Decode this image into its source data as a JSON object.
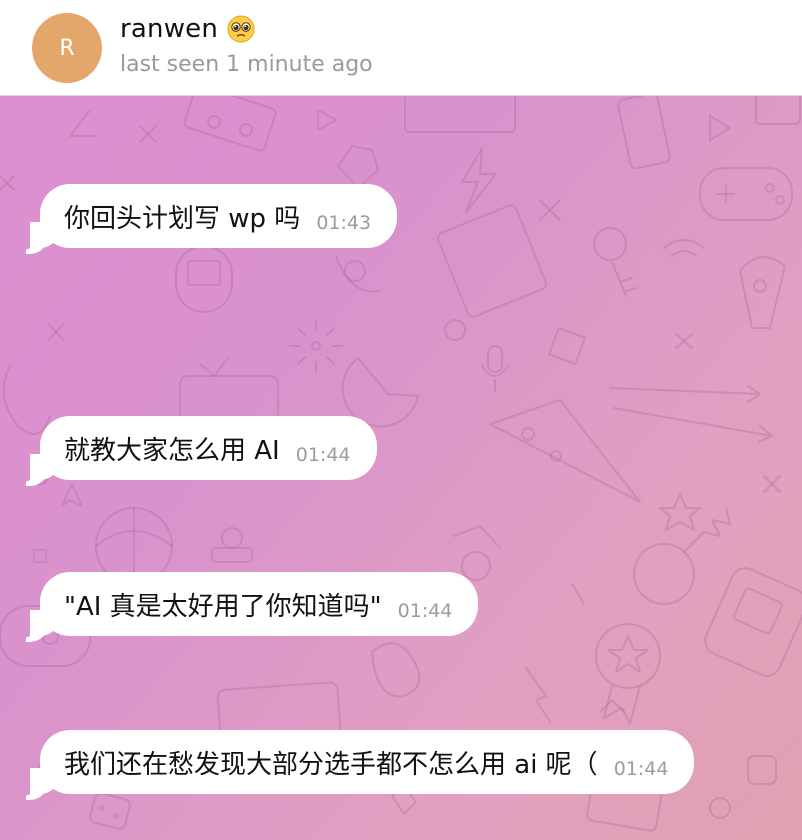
{
  "header": {
    "avatar_initial": "R",
    "name": "ranwen",
    "status": "last seen 1 minute ago"
  },
  "messages": [
    {
      "text": "你回头计划写 wp 吗",
      "time": "01:43"
    },
    {
      "text": "就教大家怎么用 AI",
      "time": "01:44"
    },
    {
      "text": "\"AI 真是太好用了你知道吗\"",
      "time": "01:44"
    },
    {
      "text": "我们还在愁发现大部分选手都不怎么用 ai 呢（",
      "time": "01:44"
    }
  ]
}
